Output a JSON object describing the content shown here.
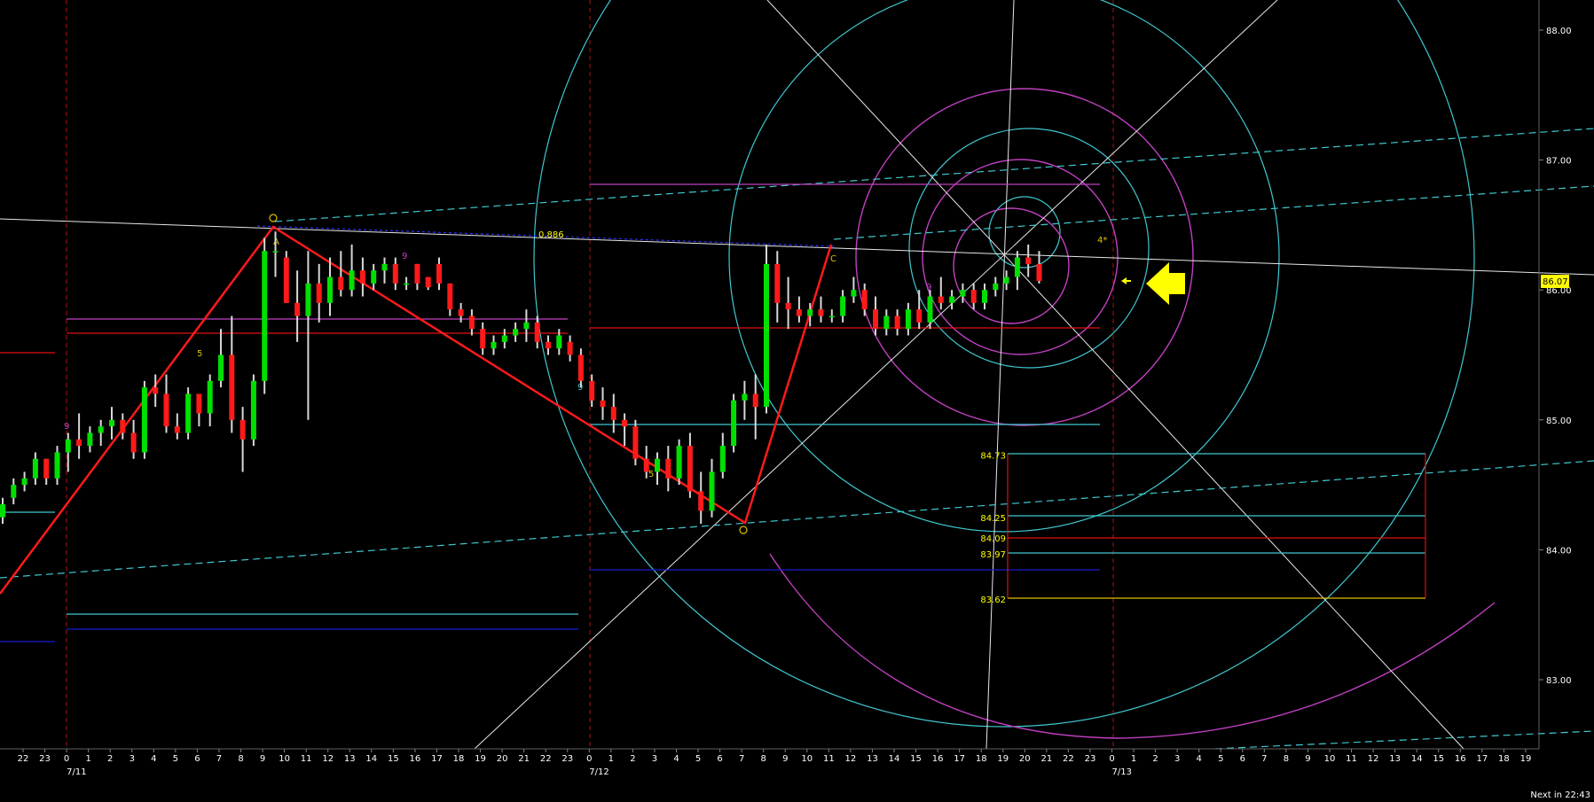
{
  "chart_data": {
    "type": "candlestick",
    "price_axis": {
      "ticks": [
        "88.00",
        "87.00",
        "86.00",
        "85.00",
        "84.00",
        "83.00"
      ],
      "ylim": [
        82.5,
        88.2
      ]
    },
    "current_price": "86.07",
    "time_axis": {
      "hour_ticks": [
        "22",
        "23",
        "0",
        "1",
        "2",
        "3",
        "4",
        "5",
        "6",
        "7",
        "8",
        "9",
        "10",
        "11",
        "12",
        "13",
        "14",
        "15",
        "16",
        "17",
        "18",
        "19",
        "20",
        "21",
        "22",
        "23",
        "0",
        "1",
        "2",
        "3",
        "4",
        "5",
        "6",
        "7",
        "8",
        "9",
        "10",
        "11",
        "12",
        "13",
        "14",
        "15",
        "16",
        "17",
        "18",
        "19",
        "20",
        "21",
        "22",
        "23",
        "0",
        "1",
        "2",
        "3",
        "4",
        "5",
        "6",
        "7",
        "8",
        "9",
        "10",
        "11",
        "12",
        "13",
        "14",
        "15",
        "16",
        "17",
        "18",
        "19"
      ],
      "date_labels": [
        {
          "label": "7/11",
          "hour_index": 2
        },
        {
          "label": "7/12",
          "hour_index": 26
        },
        {
          "label": "7/13",
          "hour_index": 50
        }
      ]
    },
    "levels": [
      "84.73",
      "84.25",
      "84.09",
      "83.97",
      "83.62"
    ],
    "fib_label": "0.886",
    "wave_labels": [
      "A",
      "C",
      "9",
      "5",
      "9",
      "5",
      "9",
      "9",
      "4*"
    ],
    "candles": [
      {
        "o": 84.25,
        "h": 84.4,
        "l": 84.2,
        "c": 84.35
      },
      {
        "o": 84.4,
        "h": 84.55,
        "l": 84.35,
        "c": 84.5
      },
      {
        "o": 84.5,
        "h": 84.6,
        "l": 84.45,
        "c": 84.55
      },
      {
        "o": 84.55,
        "h": 84.75,
        "l": 84.5,
        "c": 84.7
      },
      {
        "o": 84.7,
        "h": 84.7,
        "l": 84.5,
        "c": 84.55
      },
      {
        "o": 84.55,
        "h": 84.8,
        "l": 84.5,
        "c": 84.75
      },
      {
        "o": 84.75,
        "h": 84.9,
        "l": 84.6,
        "c": 84.85
      },
      {
        "o": 84.85,
        "h": 85.05,
        "l": 84.7,
        "c": 84.8
      },
      {
        "o": 84.8,
        "h": 84.95,
        "l": 84.75,
        "c": 84.9
      },
      {
        "o": 84.9,
        "h": 85.0,
        "l": 84.8,
        "c": 84.95
      },
      {
        "o": 84.95,
        "h": 85.1,
        "l": 84.85,
        "c": 85.0
      },
      {
        "o": 85.0,
        "h": 85.05,
        "l": 84.85,
        "c": 84.9
      },
      {
        "o": 84.9,
        "h": 85.0,
        "l": 84.7,
        "c": 84.75
      },
      {
        "o": 84.75,
        "h": 85.3,
        "l": 84.7,
        "c": 85.25
      },
      {
        "o": 85.25,
        "h": 85.35,
        "l": 85.1,
        "c": 85.2
      },
      {
        "o": 85.2,
        "h": 85.35,
        "l": 84.9,
        "c": 84.95
      },
      {
        "o": 84.95,
        "h": 85.05,
        "l": 84.85,
        "c": 84.9
      },
      {
        "o": 84.9,
        "h": 85.25,
        "l": 84.85,
        "c": 85.2
      },
      {
        "o": 85.2,
        "h": 85.2,
        "l": 84.95,
        "c": 85.05
      },
      {
        "o": 85.05,
        "h": 85.35,
        "l": 84.95,
        "c": 85.3
      },
      {
        "o": 85.3,
        "h": 85.7,
        "l": 85.25,
        "c": 85.5
      },
      {
        "o": 85.5,
        "h": 85.8,
        "l": 84.9,
        "c": 85.0
      },
      {
        "o": 85.0,
        "h": 85.1,
        "l": 84.6,
        "c": 84.85
      },
      {
        "o": 84.85,
        "h": 85.35,
        "l": 84.8,
        "c": 85.3
      },
      {
        "o": 85.3,
        "h": 86.4,
        "l": 85.2,
        "c": 86.3
      },
      {
        "o": 86.3,
        "h": 86.45,
        "l": 86.1,
        "c": 86.3
      },
      {
        "o": 86.25,
        "h": 86.3,
        "l": 85.9,
        "c": 85.9
      },
      {
        "o": 85.9,
        "h": 86.15,
        "l": 85.6,
        "c": 85.8
      },
      {
        "o": 85.8,
        "h": 86.3,
        "l": 85.0,
        "c": 86.05
      },
      {
        "o": 86.05,
        "h": 86.2,
        "l": 85.75,
        "c": 85.9
      },
      {
        "o": 85.9,
        "h": 86.25,
        "l": 85.8,
        "c": 86.1
      },
      {
        "o": 86.1,
        "h": 86.3,
        "l": 85.95,
        "c": 86.0
      },
      {
        "o": 86.0,
        "h": 86.35,
        "l": 85.95,
        "c": 86.15
      },
      {
        "o": 86.15,
        "h": 86.25,
        "l": 85.95,
        "c": 86.05
      },
      {
        "o": 86.05,
        "h": 86.2,
        "l": 86.0,
        "c": 86.15
      },
      {
        "o": 86.15,
        "h": 86.25,
        "l": 86.05,
        "c": 86.2
      },
      {
        "o": 86.2,
        "h": 86.25,
        "l": 86.0,
        "c": 86.05
      },
      {
        "o": 86.05,
        "h": 86.1,
        "l": 86.0,
        "c": 86.05
      },
      {
        "o": 86.2,
        "h": 86.2,
        "l": 86.0,
        "c": 86.05
      },
      {
        "o": 86.1,
        "h": 86.1,
        "l": 86.0,
        "c": 86.02
      },
      {
        "o": 86.2,
        "h": 86.25,
        "l": 86.0,
        "c": 86.05
      },
      {
        "o": 86.05,
        "h": 86.05,
        "l": 85.8,
        "c": 85.85
      },
      {
        "o": 85.85,
        "h": 85.9,
        "l": 85.75,
        "c": 85.8
      },
      {
        "o": 85.8,
        "h": 85.85,
        "l": 85.65,
        "c": 85.7
      },
      {
        "o": 85.7,
        "h": 85.75,
        "l": 85.5,
        "c": 85.55
      },
      {
        "o": 85.55,
        "h": 85.65,
        "l": 85.5,
        "c": 85.6
      },
      {
        "o": 85.6,
        "h": 85.7,
        "l": 85.55,
        "c": 85.65
      },
      {
        "o": 85.65,
        "h": 85.75,
        "l": 85.6,
        "c": 85.7
      },
      {
        "o": 85.7,
        "h": 85.85,
        "l": 85.6,
        "c": 85.75
      },
      {
        "o": 85.75,
        "h": 85.8,
        "l": 85.55,
        "c": 85.6
      },
      {
        "o": 85.6,
        "h": 85.65,
        "l": 85.5,
        "c": 85.55
      },
      {
        "o": 85.55,
        "h": 85.7,
        "l": 85.5,
        "c": 85.65
      },
      {
        "o": 85.6,
        "h": 85.65,
        "l": 85.45,
        "c": 85.5
      },
      {
        "o": 85.5,
        "h": 85.55,
        "l": 85.25,
        "c": 85.3
      },
      {
        "o": 85.3,
        "h": 85.35,
        "l": 85.1,
        "c": 85.15
      },
      {
        "o": 85.15,
        "h": 85.25,
        "l": 85.0,
        "c": 85.1
      },
      {
        "o": 85.1,
        "h": 85.2,
        "l": 84.9,
        "c": 85.0
      },
      {
        "o": 85.0,
        "h": 85.05,
        "l": 84.8,
        "c": 84.95
      },
      {
        "o": 84.95,
        "h": 85.0,
        "l": 84.65,
        "c": 84.7
      },
      {
        "o": 84.7,
        "h": 84.8,
        "l": 84.55,
        "c": 84.6
      },
      {
        "o": 84.6,
        "h": 84.75,
        "l": 84.5,
        "c": 84.7
      },
      {
        "o": 84.7,
        "h": 84.8,
        "l": 84.45,
        "c": 84.55
      },
      {
        "o": 84.55,
        "h": 84.85,
        "l": 84.5,
        "c": 84.8
      },
      {
        "o": 84.8,
        "h": 84.9,
        "l": 84.4,
        "c": 84.45
      },
      {
        "o": 84.45,
        "h": 84.6,
        "l": 84.2,
        "c": 84.3
      },
      {
        "o": 84.3,
        "h": 84.7,
        "l": 84.25,
        "c": 84.6
      },
      {
        "o": 84.6,
        "h": 84.9,
        "l": 84.55,
        "c": 84.8
      },
      {
        "o": 84.8,
        "h": 85.2,
        "l": 84.75,
        "c": 85.15
      },
      {
        "o": 85.15,
        "h": 85.3,
        "l": 85.0,
        "c": 85.2
      },
      {
        "o": 85.2,
        "h": 85.35,
        "l": 84.85,
        "c": 85.1
      },
      {
        "o": 85.1,
        "h": 86.35,
        "l": 85.05,
        "c": 86.2
      },
      {
        "o": 86.2,
        "h": 86.3,
        "l": 85.75,
        "c": 85.9
      },
      {
        "o": 85.9,
        "h": 86.1,
        "l": 85.7,
        "c": 85.85
      },
      {
        "o": 85.85,
        "h": 85.95,
        "l": 85.75,
        "c": 85.8
      },
      {
        "o": 85.8,
        "h": 85.9,
        "l": 85.72,
        "c": 85.85
      },
      {
        "o": 85.85,
        "h": 85.95,
        "l": 85.75,
        "c": 85.8
      },
      {
        "o": 85.8,
        "h": 85.85,
        "l": 85.75,
        "c": 85.8
      },
      {
        "o": 85.8,
        "h": 86.0,
        "l": 85.75,
        "c": 85.95
      },
      {
        "o": 85.95,
        "h": 86.1,
        "l": 85.9,
        "c": 86.0
      },
      {
        "o": 86.0,
        "h": 86.05,
        "l": 85.8,
        "c": 85.85
      },
      {
        "o": 85.85,
        "h": 85.95,
        "l": 85.65,
        "c": 85.7
      },
      {
        "o": 85.7,
        "h": 85.85,
        "l": 85.65,
        "c": 85.8
      },
      {
        "o": 85.8,
        "h": 85.85,
        "l": 85.65,
        "c": 85.7
      },
      {
        "o": 85.7,
        "h": 85.9,
        "l": 85.65,
        "c": 85.85
      },
      {
        "o": 85.85,
        "h": 86.0,
        "l": 85.7,
        "c": 85.75
      },
      {
        "o": 85.75,
        "h": 86.0,
        "l": 85.7,
        "c": 85.95
      },
      {
        "o": 85.95,
        "h": 86.1,
        "l": 85.85,
        "c": 85.9
      },
      {
        "o": 85.9,
        "h": 86.0,
        "l": 85.85,
        "c": 85.95
      },
      {
        "o": 85.95,
        "h": 86.05,
        "l": 85.9,
        "c": 86.0
      },
      {
        "o": 86.0,
        "h": 86.05,
        "l": 85.85,
        "c": 85.9
      },
      {
        "o": 85.9,
        "h": 86.05,
        "l": 85.85,
        "c": 86.0
      },
      {
        "o": 86.0,
        "h": 86.1,
        "l": 85.95,
        "c": 86.05
      },
      {
        "o": 86.05,
        "h": 86.15,
        "l": 86.0,
        "c": 86.1
      },
      {
        "o": 86.1,
        "h": 86.3,
        "l": 86.0,
        "c": 86.25
      },
      {
        "o": 86.25,
        "h": 86.35,
        "l": 86.1,
        "c": 86.2
      },
      {
        "o": 86.2,
        "h": 86.3,
        "l": 86.05,
        "c": 86.07
      }
    ]
  },
  "footer": {
    "countdown": "Next in 22:43"
  },
  "colors": {
    "bull": "#00e000",
    "bear": "#ff1a1a",
    "neutral": "#ffffff",
    "cyan": "#40d0d0",
    "magenta": "#c040c0",
    "red": "#e01010",
    "yellow": "#ffff00",
    "blue": "#1a1ad0"
  },
  "icons": {
    "current_arrow": "yellow-left-arrow-icon"
  }
}
